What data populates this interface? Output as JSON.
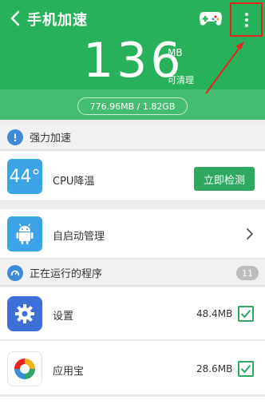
{
  "header": {
    "title": "手机加速",
    "back_icon": "chevron-left-icon",
    "game_icon": "gamepad-icon",
    "menu_icon": "more-vertical-icon",
    "big_number": "136",
    "unit": "MB",
    "clean_label": "可清理",
    "memory_usage": "776.96MB / 1.82GB"
  },
  "colors": {
    "header_green": "#27b15a",
    "button_green": "#2ea760",
    "highlight_red": "#e5241f",
    "icon_blue": "#3ba3e6"
  },
  "boost_section": {
    "title": "强力加速",
    "icon": "exclamation-circle-icon"
  },
  "cpu_row": {
    "icon_text": "44°",
    "label": "CPU降温",
    "button": "立即检测"
  },
  "autostart_row": {
    "icon": "android-icon",
    "label": "自启动管理"
  },
  "running_section": {
    "title": "正在运行的程序",
    "icon": "speedometer-icon",
    "count": "11"
  },
  "apps": [
    {
      "name": "设置",
      "size": "48.4MB",
      "icon": "gear-icon",
      "checked": true
    },
    {
      "name": "应用宝",
      "size": "28.6MB",
      "icon": "app-store-icon",
      "checked": true
    }
  ]
}
